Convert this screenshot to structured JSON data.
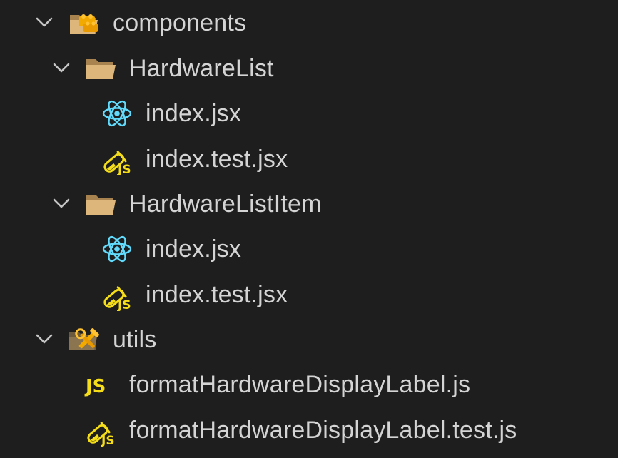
{
  "explorer": {
    "components": {
      "label": "components",
      "icon": "components-folder-icon",
      "expanded": true,
      "children": {
        "hardware_list": {
          "label": "HardwareList",
          "icon": "folder-open-icon",
          "expanded": true,
          "files": [
            {
              "label": "index.jsx",
              "icon": "react-icon"
            },
            {
              "label": "index.test.jsx",
              "icon": "test-js-icon"
            }
          ]
        },
        "hardware_list_item": {
          "label": "HardwareListItem",
          "icon": "folder-open-icon",
          "expanded": true,
          "files": [
            {
              "label": "index.jsx",
              "icon": "react-icon"
            },
            {
              "label": "index.test.jsx",
              "icon": "test-js-icon"
            }
          ]
        }
      }
    },
    "utils": {
      "label": "utils",
      "icon": "utils-folder-icon",
      "expanded": true,
      "files": [
        {
          "label": "formatHardwareDisplayLabel.js",
          "icon": "javascript-icon",
          "icon_text": "JS"
        },
        {
          "label": "formatHardwareDisplayLabel.test.js",
          "icon": "test-js-icon"
        }
      ]
    }
  },
  "colors": {
    "background": "#1e1e1e",
    "text": "#d4d4d4",
    "folder": "#dcb67a",
    "react": "#61dafb",
    "javascript": "#f5de19",
    "indent_guide": "#585858"
  }
}
